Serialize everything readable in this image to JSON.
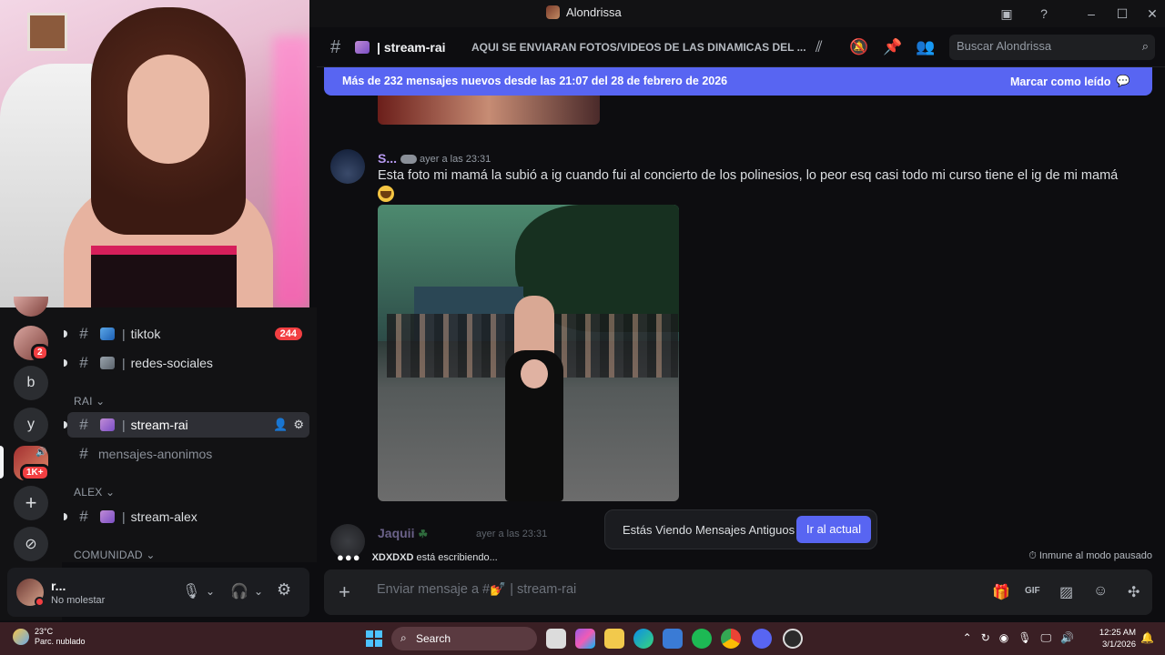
{
  "window": {
    "title": "Alondrissa"
  },
  "server_rail": {
    "badges": {
      "server2": "2",
      "server5": "1K+"
    },
    "letter_servers": [
      "b",
      "y"
    ]
  },
  "channels": {
    "items": [
      {
        "name": "tiktok",
        "badge": "244"
      },
      {
        "name": "redes-sociales"
      }
    ],
    "category_rai": "RAI",
    "rai_items": [
      {
        "name": "stream-rai"
      },
      {
        "name": "mensajes-anonimos"
      }
    ],
    "category_alex": "ALEX",
    "alex_items": [
      {
        "name": "stream-alex"
      }
    ],
    "category_comunidad": "COMUNIDAD"
  },
  "user": {
    "name": "r...",
    "status": "No molestar"
  },
  "header": {
    "channel": "stream-rai",
    "topic": "AQUI SE ENVIARAN FOTOS/VIDEOS DE LAS DINAMICAS DEL ...",
    "search_placeholder": "Buscar Alondrissa"
  },
  "new_messages_bar": {
    "text": "Más de 232 mensajes nuevos desde las 21:07 del 28 de febrero de 2026",
    "action": "Marcar como leído"
  },
  "messages": [
    {
      "author": "S...",
      "time": "ayer a las 23:31",
      "text": "Esta foto mi mamá la subió a ig cuando fui al concierto de los polinesios, lo peor esq casi todo mi curso tiene el ig de mi mamá"
    },
    {
      "author": "Jaquii",
      "time": "ayer a las 23:31"
    }
  ],
  "jump": {
    "text": "Estás Viendo Mensajes Antiguos",
    "button": "Ir al actual"
  },
  "typing": {
    "user": "XDXDXD",
    "suffix": " está escribiendo..."
  },
  "immune": "Inmune al modo pausado",
  "composer": {
    "placeholder": "Enviar mensaje a #💅 | stream-rai"
  },
  "taskbar": {
    "weather_temp": "23°C",
    "weather_desc": "Parc. nublado",
    "search": "Search",
    "time": "12:25 AM",
    "date": "3/1/2026"
  }
}
